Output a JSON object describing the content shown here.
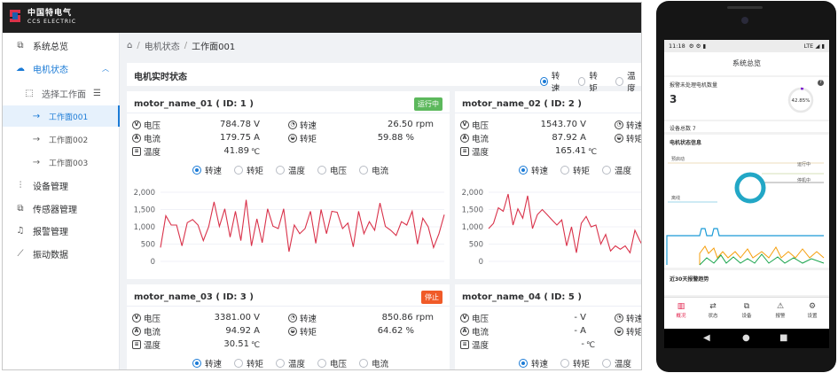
{
  "desktop": {
    "logo": {
      "cn": "中国特电气",
      "en": "CCS ELECTRIC"
    },
    "sidebar": [
      {
        "label": "系统总览",
        "icon": "hierarchy-icon"
      },
      {
        "label": "电机状态",
        "icon": "cloud-icon",
        "expanded": true
      },
      {
        "label": "选择工作面",
        "icon": "select-icon"
      },
      {
        "label": "工作面001",
        "icon": "arrow-right-icon",
        "selected": true
      },
      {
        "label": "工作面002",
        "icon": "arrow-right-icon"
      },
      {
        "label": "工作面003",
        "icon": "arrow-right-icon"
      },
      {
        "label": "设备管理",
        "icon": "sliders-icon"
      },
      {
        "label": "传感器管理",
        "icon": "hierarchy-icon"
      },
      {
        "label": "报警管理",
        "icon": "bell-icon"
      },
      {
        "label": "振动数据",
        "icon": "trend-icon"
      }
    ],
    "breadcrumb": {
      "level1": "电机状态",
      "level2": "工作面001"
    },
    "panel_title": "电机实时状态",
    "panel_radios": [
      "转速",
      "转矩",
      "温度"
    ],
    "card_radios": [
      "转速",
      "转矩",
      "温度",
      "电压",
      "电流"
    ],
    "labels": {
      "voltage": "电压",
      "current": "电流",
      "temp": "温度",
      "speed": "转速",
      "torque": "转矩"
    },
    "cards": [
      {
        "title": "motor_name_01 ( ID: 1 )",
        "status": "运行中",
        "status_color": "#5cb85c",
        "voltage": "784.78 V",
        "current": "179.75 A",
        "temp_num": "41.89",
        "temp_unit": "℃",
        "speed": "26.50 rpm",
        "torque": "59.88 %"
      },
      {
        "title": "motor_name_02 ( ID: 2 )",
        "status": "",
        "voltage": "1543.70 V",
        "current": "87.92 A",
        "temp_num": "165.41",
        "temp_unit": "℃",
        "speed": "",
        "torque": ""
      },
      {
        "title": "motor_name_03 ( ID: 3 )",
        "status": "停止",
        "status_color": "#f05a28",
        "voltage": "3381.00 V",
        "current": "94.92 A",
        "temp_num": "30.51",
        "temp_unit": "℃",
        "speed": "850.86 rpm",
        "torque": "64.62 %"
      },
      {
        "title": "motor_name_04 ( ID: 5 )",
        "status": "",
        "voltage": "- V",
        "current": "- A",
        "temp_num": "-",
        "temp_unit": "℃",
        "speed": "",
        "torque": ""
      }
    ]
  },
  "mobile": {
    "status_bar": {
      "time": "11:18",
      "right": "LTE ◢ ▮"
    },
    "title": "系统总览",
    "alarm_label": "报警未处理电机数量",
    "alarm_count": "3",
    "percent": "42.85%",
    "device_total": "设备总数  7",
    "status_section": "电机状态信息",
    "pie_labels": {
      "startup": "预启动",
      "running": "运行中",
      "stopped": "停机中",
      "offline": "离线"
    },
    "trend_section": "近30天报警趋势",
    "tabs": [
      {
        "label": "概况",
        "icon": "chart-icon",
        "active": true
      },
      {
        "label": "状态",
        "icon": "swap-icon"
      },
      {
        "label": "设备",
        "icon": "hierarchy-icon"
      },
      {
        "label": "报警",
        "icon": "alarm-icon"
      },
      {
        "label": "设置",
        "icon": "gear-icon"
      }
    ]
  },
  "chart_data": [
    {
      "type": "line",
      "name": "motor_name_01 ( ID: 1 )",
      "ylim": [
        0,
        2000
      ],
      "yticks": [
        "2,000",
        "1,500",
        "1,000",
        "500",
        "0"
      ],
      "color": "#d9324a",
      "values": [
        400,
        1320,
        1050,
        1050,
        450,
        1120,
        1210,
        1050,
        600,
        1000,
        1720,
        1010,
        1520,
        700,
        1450,
        600,
        1780,
        450,
        1230,
        540,
        1520,
        1020,
        950,
        1520,
        280,
        1050,
        800,
        950,
        1450,
        520,
        1500,
        800,
        1450,
        1420,
        950,
        1110,
        420,
        1450,
        800,
        1150,
        900,
        1690,
        1010,
        900,
        750,
        1150,
        1050,
        1450,
        500,
        1250,
        1000,
        400,
        800,
        1350
      ]
    },
    {
      "type": "line",
      "name": "motor_name_02 ( ID: 2 )",
      "ylim": [
        0,
        2000
      ],
      "yticks": [
        "2,000",
        "1,500",
        "1,000",
        "500",
        "0"
      ],
      "color": "#d9324a",
      "values": [
        950,
        1100,
        1550,
        1450,
        1950,
        1050,
        1520,
        1250,
        1900,
        950,
        1350,
        1500,
        1350,
        1200,
        1050,
        1200,
        450,
        1000,
        250,
        1100,
        1300,
        1000,
        1050,
        500,
        780,
        300,
        450,
        350,
        450,
        250,
        900,
        600,
        350
      ]
    }
  ]
}
